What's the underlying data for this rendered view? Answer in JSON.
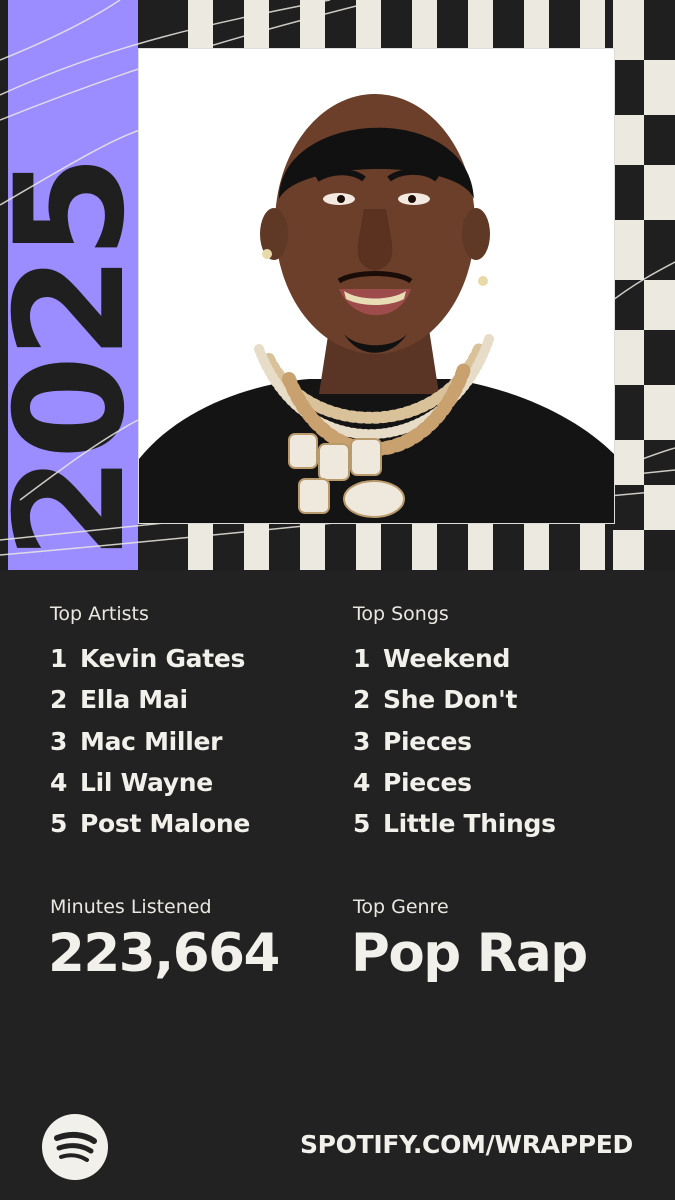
{
  "year_graphic": "2025",
  "top_artists": {
    "label": "Top Artists",
    "items": [
      {
        "rank": "1",
        "name": "Kevin Gates"
      },
      {
        "rank": "2",
        "name": "Ella Mai"
      },
      {
        "rank": "3",
        "name": "Mac Miller"
      },
      {
        "rank": "4",
        "name": "Lil Wayne"
      },
      {
        "rank": "5",
        "name": "Post Malone"
      }
    ]
  },
  "top_songs": {
    "label": "Top Songs",
    "items": [
      {
        "rank": "1",
        "name": "Weekend"
      },
      {
        "rank": "2",
        "name": "She Don't"
      },
      {
        "rank": "3",
        "name": "Pieces"
      },
      {
        "rank": "4",
        "name": "Pieces"
      },
      {
        "rank": "5",
        "name": "Little Things"
      }
    ]
  },
  "minutes": {
    "label": "Minutes Listened",
    "value": "223,664"
  },
  "genre": {
    "label": "Top Genre",
    "value": "Pop Rap"
  },
  "footer": {
    "url": "SPOTIFY.COM/WRAPPED",
    "logo_icon": "spotify-logo-icon"
  },
  "colors": {
    "background": "#222222",
    "accent": "#9b8cff",
    "text": "#f2f0ea"
  }
}
